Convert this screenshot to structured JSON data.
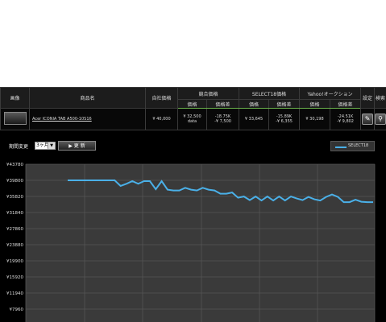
{
  "table": {
    "headers": {
      "image": "画像",
      "product_name": "商品名",
      "own_price": "自社価格",
      "competitor_price": "競合価格",
      "select18_price": "SELECT18価格",
      "yahoo_auction": "Yahoo!オークション",
      "settings": "設定",
      "search": "検索"
    },
    "subheaders": [
      "価格",
      "価格差",
      "価格",
      "価格差",
      "価格",
      "価格差"
    ],
    "row": {
      "product_name": "Acer ICONIA TAB A500-10S16",
      "own_price": "¥ 40,000",
      "competitor_price": "¥ 32,500",
      "competitor_note": "data",
      "competitor_diff_pct": "-18.75K",
      "competitor_diff": "-¥ 7,500",
      "select18_price": "¥ 33,645",
      "select18_diff_pct": "-15.89K",
      "select18_diff": "-¥ 6,355",
      "yahoo_price": "¥ 30,198",
      "yahoo_diff_pct": "-24.51K",
      "yahoo_diff": "-¥ 9,802",
      "settings_icon": "wrench-icon",
      "search_icon": "search-icon"
    }
  },
  "controls": {
    "period_label": "期間変更",
    "period_value": "3ヶ月",
    "update_button": "▶ 更 新"
  },
  "colors": {
    "line": "#4ab0e8",
    "red": "#e03030",
    "accent": "#6ab04c"
  },
  "chart_data": {
    "type": "line",
    "y_ticks": [
      "¥43780",
      "¥39800",
      "¥35820",
      "¥31840",
      "¥27860",
      "¥23880",
      "¥19900",
      "¥15920",
      "¥11940",
      "¥7960"
    ],
    "ylim": [
      7960,
      43780
    ],
    "grid": true,
    "legend_position": "top-right",
    "series": [
      {
        "name": "SELECT18",
        "values": [
          39800,
          39800,
          39800,
          39800,
          39800,
          39800,
          39800,
          39800,
          39800,
          38400,
          38950,
          39600,
          38950,
          39600,
          39600,
          37600,
          39600,
          37500,
          37300,
          37300,
          37950,
          37500,
          37300,
          37950,
          37500,
          37300,
          36500,
          36500,
          36800,
          35500,
          35800,
          34900,
          35800,
          34800,
          35800,
          34800,
          35800,
          34800,
          35800,
          35300,
          34900,
          35700,
          35100,
          34800,
          35700,
          36300,
          35700,
          34400,
          34400,
          35000,
          34500,
          34400,
          34400
        ]
      }
    ]
  }
}
